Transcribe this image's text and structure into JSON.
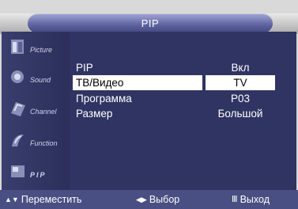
{
  "title": "PIP",
  "sidebar": [
    {
      "icon": "picture-icon",
      "label": "Picture"
    },
    {
      "icon": "sound-icon",
      "label": "Sound"
    },
    {
      "icon": "channel-icon",
      "label": "Channel"
    },
    {
      "icon": "function-icon",
      "label": "Function"
    },
    {
      "icon": "pip-icon",
      "label": "PIP"
    }
  ],
  "menu": [
    {
      "label": "PIP",
      "value": "Вкл"
    },
    {
      "label": "ТВ/Видео",
      "value": "TV"
    },
    {
      "label": "Программа",
      "value": "P03"
    },
    {
      "label": "Размер",
      "value": "Большой"
    }
  ],
  "hints": {
    "move_glyph": "▲▼",
    "move": "Переместить",
    "select_glyph": "◀▶",
    "select": "Выбор",
    "exit_glyph": "Ⅲ",
    "exit": "Выход"
  }
}
